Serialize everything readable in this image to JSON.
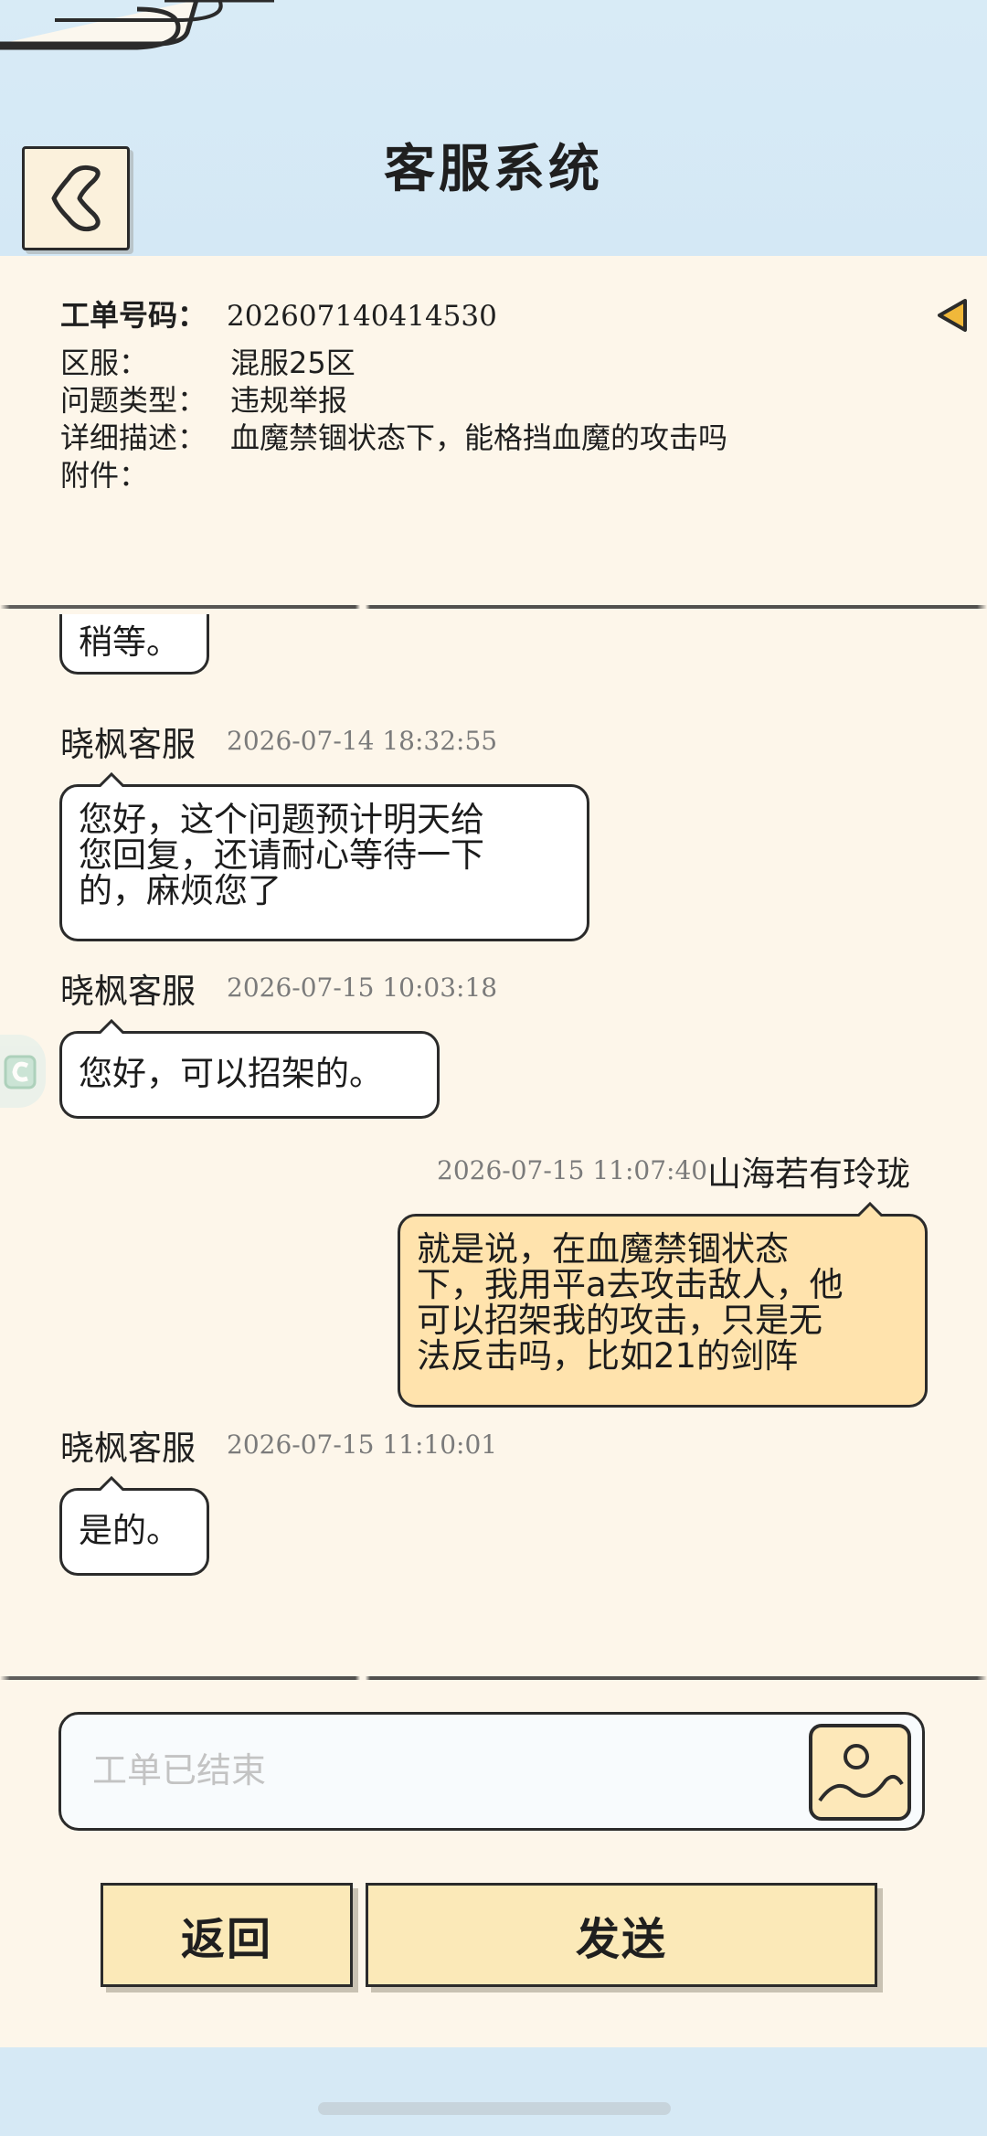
{
  "header": {
    "title": "客服系统",
    "back_icon": "back-heart-icon"
  },
  "ticket": {
    "number_label": "工单号码：",
    "number_value": "202607140414530",
    "rows": [
      {
        "label": "区服：",
        "value": "混服25区"
      },
      {
        "label": "问题类型：",
        "value": "违规举报"
      },
      {
        "label": "详细描述：",
        "value": "血魔禁锢状态下，能格挡血魔的攻击吗"
      },
      {
        "label": "附件：",
        "value": ""
      }
    ]
  },
  "messages": [
    {
      "text": "稍等。"
    },
    {
      "sender": "晓枫客服",
      "time": "2026-07-14 18:32:55",
      "lines": [
        "您好，这个问题预计明天给",
        "您回复，还请耐心等待一下",
        "的，麻烦您了"
      ]
    },
    {
      "sender": "晓枫客服",
      "time": "2026-07-15 10:03:18",
      "text": "您好，可以招架的。"
    },
    {
      "sender": "山海若有玲珑",
      "time": "2026-07-15 11:07:40",
      "lines": [
        "就是说，在血魔禁锢状态",
        "下，我用平a去攻击敌人，他",
        "可以招架我的攻击，只是无",
        "法反击吗，比如21的剑阵"
      ]
    },
    {
      "sender": "晓枫客服",
      "time": "2026-07-15 11:10:01",
      "text": "是的。"
    }
  ],
  "input": {
    "placeholder": "工单已结束",
    "image_icon": "image-upload-icon"
  },
  "buttons": {
    "back": "返回",
    "send": "发送"
  },
  "colors": {
    "accent": "#fbe9b8",
    "user_bubble": "#ffe3ad",
    "panel": "#fdf6ea",
    "header": "#d6e9f5"
  }
}
